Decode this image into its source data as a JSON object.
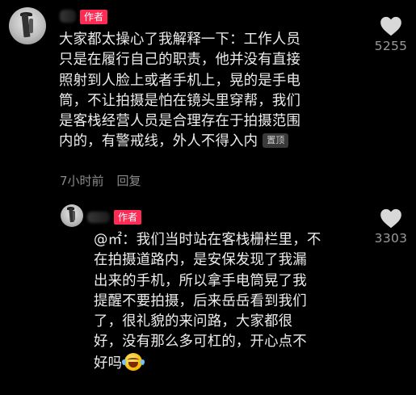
{
  "comment": {
    "author_badge": "作者",
    "text": "大家都太操心了我解释一下：工作人员\n只是在履行自己的职责，他并没有直接\n照射到人脸上或者手机上，晃的是手电\n筒，不让拍摄是怕在镜头里穿帮，我们\n是客栈经营人员是合理存在于拍摄范围\n内的，有警戒线，外人不得入内",
    "pinned_label": "置顶",
    "time": "7小时前",
    "reply_label": "回复",
    "like_icon": "heart-icon",
    "like_count": "5255"
  },
  "reply": {
    "author_badge": "作者",
    "text": "@㎡：我们当时站在客栈栅栏里，不\n在拍摄道路内，是安保发现了我漏\n出来的手机，所以拿手电筒晃了我\n提醒不要拍摄，后来岳岳看到我们\n了，很礼貌的来问路，大家都很\n好，没有那么多可杠的，开心点不\n好吗",
    "emoji_icon": "laughing-tears-emoji",
    "like_icon": "heart-icon",
    "like_count": "3303"
  },
  "colors": {
    "background": "#000000",
    "author_badge": "#fe2c55",
    "like_heart": "#d8d8d8",
    "meta_text": "#8a8a8a"
  }
}
